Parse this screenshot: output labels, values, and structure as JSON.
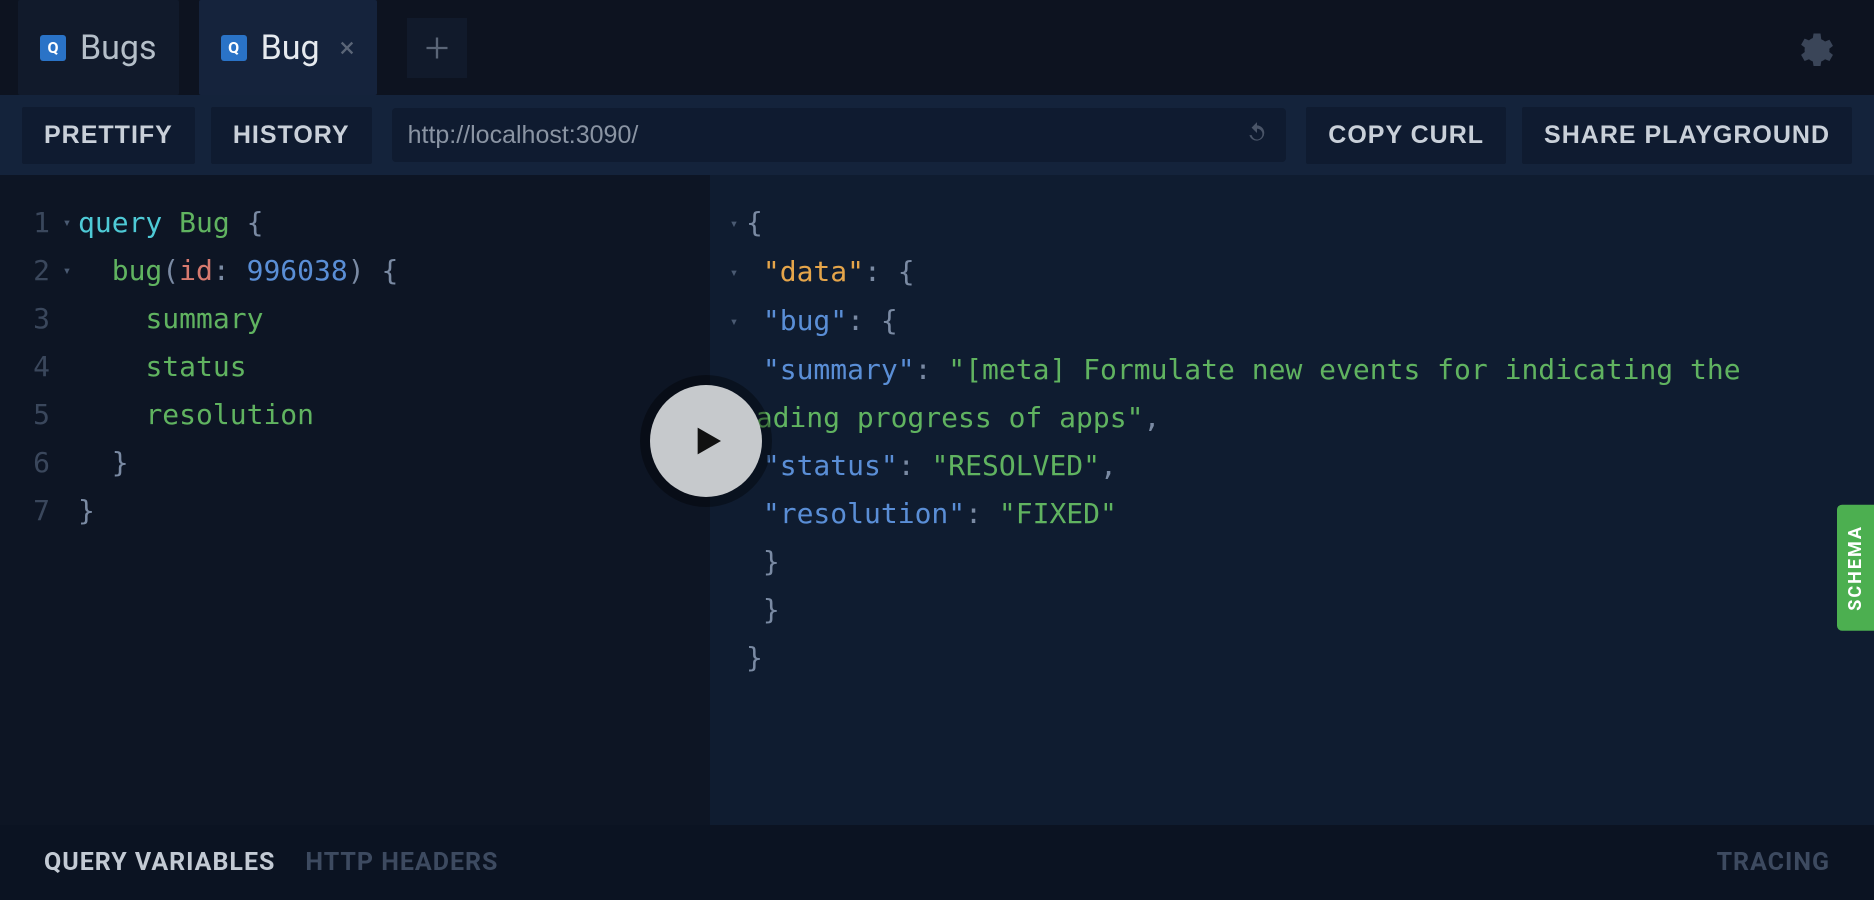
{
  "tabs": [
    {
      "label": "Bugs",
      "badge": "Q",
      "active": false
    },
    {
      "label": "Bug",
      "badge": "Q",
      "active": true
    }
  ],
  "toolbar": {
    "prettify": "PRETTIFY",
    "history": "HISTORY",
    "url": "http://localhost:3090/",
    "copy_curl": "COPY CURL",
    "share": "SHARE PLAYGROUND"
  },
  "editor": {
    "lines": [
      {
        "n": "1",
        "fold": "▾",
        "tokens": [
          {
            "t": "query ",
            "c": "kw"
          },
          {
            "t": "Bug ",
            "c": "name"
          },
          {
            "t": "{",
            "c": "punct"
          }
        ]
      },
      {
        "n": "2",
        "fold": "▾",
        "indent": 1,
        "tokens": [
          {
            "t": "bug",
            "c": "name"
          },
          {
            "t": "(",
            "c": "punct"
          },
          {
            "t": "id",
            "c": "arg"
          },
          {
            "t": ": ",
            "c": "punct"
          },
          {
            "t": "996038",
            "c": "num"
          },
          {
            "t": ") {",
            "c": "punct"
          }
        ]
      },
      {
        "n": "3",
        "fold": "",
        "indent": 2,
        "tokens": [
          {
            "t": "summary",
            "c": "field"
          }
        ]
      },
      {
        "n": "4",
        "fold": "",
        "indent": 2,
        "tokens": [
          {
            "t": "status",
            "c": "field"
          }
        ]
      },
      {
        "n": "5",
        "fold": "",
        "indent": 2,
        "tokens": [
          {
            "t": "resolution",
            "c": "field"
          }
        ]
      },
      {
        "n": "6",
        "fold": "",
        "indent": 1,
        "tokens": [
          {
            "t": "}",
            "c": "punct"
          }
        ]
      },
      {
        "n": "7",
        "fold": "",
        "indent": 0,
        "tokens": [
          {
            "t": "}",
            "c": "punct"
          }
        ]
      }
    ]
  },
  "result": {
    "data": {
      "bug": {
        "summary": "[meta] Formulate new events for indicating the loading progress of apps",
        "status": "RESOLVED",
        "resolution": "FIXED"
      }
    }
  },
  "schema_label": "SCHEMA",
  "bottom": {
    "query_vars": "QUERY VARIABLES",
    "http_headers": "HTTP HEADERS",
    "tracing": "TRACING"
  }
}
